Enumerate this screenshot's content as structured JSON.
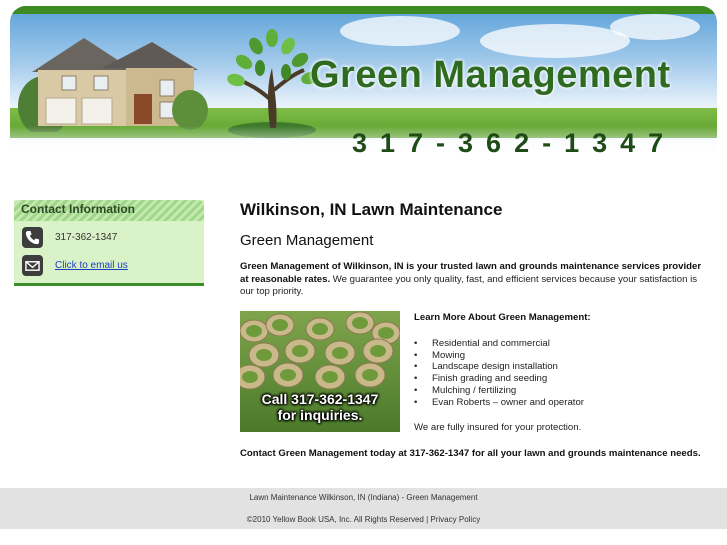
{
  "header": {
    "brand_name": "Green Management",
    "phone_display": "317-362-1347"
  },
  "sidebar": {
    "contact_title": "Contact Information",
    "phone": "317-362-1347",
    "email_link": "Click to email us"
  },
  "main": {
    "title": "Wilkinson, IN Lawn Maintenance",
    "subtitle": "Green Management",
    "intro_bold": "Green Management of Wilkinson, IN is your trusted lawn and grounds maintenance services provider at reasonable rates.",
    "intro_rest": " We guarantee you only quality, fast, and efficient services because your satisfaction is our top priority.",
    "photo_caption_line1": "Call 317-362-1347",
    "photo_caption_line2": "for inquiries.",
    "learn_heading": "Learn More About Green Management:",
    "services": [
      "Residential and commercial",
      "Mowing",
      "Landscape design installation",
      "Finish grading and seeding",
      "Mulching / fertilizing",
      "Evan Roberts – owner and operator"
    ],
    "insured": "We are fully insured for your protection.",
    "cta": "Contact Green Management today at 317-362-1347 for all your lawn and grounds maintenance needs."
  },
  "footer": {
    "title": "Lawn Maintenance Wilkinson, IN (Indiana) - Green Management",
    "copyright": "©2010 Yellow Book USA, Inc. All Rights Reserved | Privacy Policy"
  },
  "colors": {
    "brand_green": "#2f6a21",
    "contact_bg": "#d9f2c7",
    "link": "#1a3fbf",
    "footer_bg": "#e2e2e2"
  },
  "icons": [
    "phone-icon",
    "email-icon",
    "tree-logo-icon"
  ]
}
